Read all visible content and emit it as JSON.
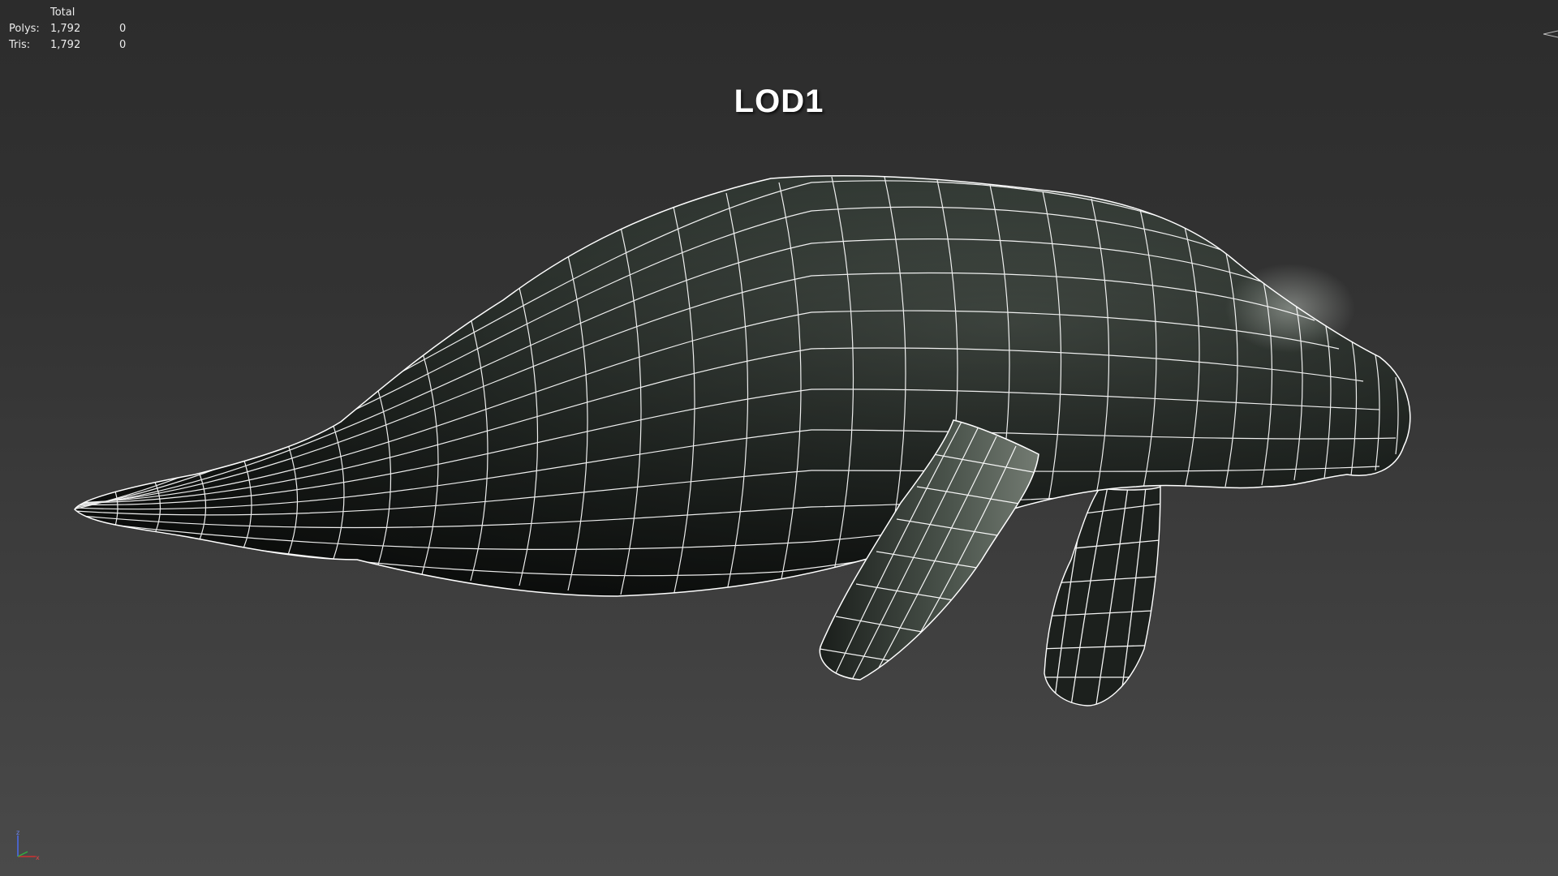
{
  "stats": {
    "header": "Total",
    "rows": [
      {
        "label": "Polys:",
        "value": "1,792",
        "selected": "0"
      },
      {
        "label": "Tris:",
        "value": "1,792",
        "selected": "0"
      }
    ]
  },
  "viewport": {
    "title": "LOD1"
  },
  "gizmo": {
    "z_label": "z",
    "x_label": "x"
  },
  "colors": {
    "background_top": "#2c2c2c",
    "background_bottom": "#4a4a4a",
    "wireframe": "#ffffff",
    "model_fill": "#2e342f"
  },
  "icons": {
    "axis": "axis-gizmo-icon"
  }
}
